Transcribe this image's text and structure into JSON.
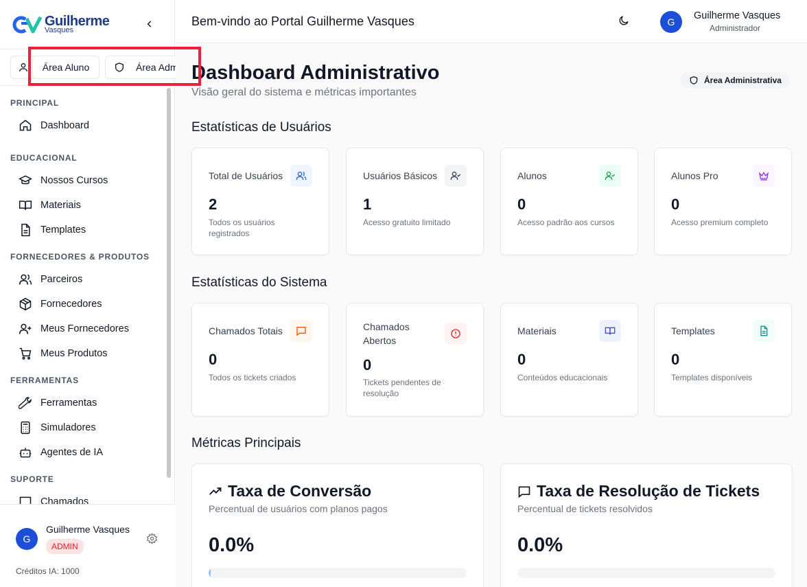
{
  "sidebar": {
    "logo_text_1": "Guilherme",
    "logo_text_2": "Vasques",
    "area_aluno": "Área Aluno",
    "area_admin": "Área Admin",
    "sections": [
      {
        "title": "PRINCIPAL",
        "items": [
          {
            "label": "Dashboard",
            "icon": "home-icon"
          }
        ]
      },
      {
        "title": "EDUCACIONAL",
        "items": [
          {
            "label": "Nossos Cursos",
            "icon": "graduation-cap-icon"
          },
          {
            "label": "Materiais",
            "icon": "book-open-icon"
          },
          {
            "label": "Templates",
            "icon": "file-text-icon"
          }
        ]
      },
      {
        "title": "FORNECEDORES & PRODUTOS",
        "items": [
          {
            "label": "Parceiros",
            "icon": "users-icon"
          },
          {
            "label": "Fornecedores",
            "icon": "package-icon"
          },
          {
            "label": "Meus Fornecedores",
            "icon": "user-plus-icon"
          },
          {
            "label": "Meus Produtos",
            "icon": "cart-icon"
          }
        ]
      },
      {
        "title": "FERRAMENTAS",
        "items": [
          {
            "label": "Ferramentas",
            "icon": "wrench-icon"
          },
          {
            "label": "Simuladores",
            "icon": "calculator-icon"
          },
          {
            "label": "Agentes de IA",
            "icon": "bot-icon"
          }
        ]
      },
      {
        "title": "SUPORTE",
        "items": [
          {
            "label": "Chamados",
            "icon": "message-icon"
          }
        ]
      }
    ],
    "user": {
      "initial": "G",
      "name": "Guilherme Vasques",
      "badge": "ADMIN",
      "credits": "Créditos IA: 1000"
    }
  },
  "header": {
    "title": "Bem-vindo ao Portal Guilherme Vasques",
    "user_initial": "G",
    "user_name": "Guilherme Vasques",
    "user_role": "Administrador"
  },
  "main": {
    "title": "Dashboard Administrativo",
    "subtitle": "Visão geral do sistema e métricas importantes",
    "badge": "Área Administrativa",
    "user_stats_title": "Estatísticas de Usuários",
    "system_stats_title": "Estatísticas do Sistema",
    "metrics_title": "Métricas Principais",
    "user_stats": [
      {
        "label": "Total de Usuários",
        "value": "2",
        "desc": "Todos os usuários registrados",
        "icon": "users-icon",
        "color": "#2563eb",
        "bg": "#eff6ff"
      },
      {
        "label": "Usuários Básicos",
        "value": "1",
        "desc": "Acesso gratuito limitado",
        "icon": "user-check-icon",
        "color": "#374151",
        "bg": "#f3f4f6"
      },
      {
        "label": "Alunos",
        "value": "0",
        "desc": "Acesso padrão aos cursos",
        "icon": "user-check-icon",
        "color": "#16a34a",
        "bg": "#ecfdf5"
      },
      {
        "label": "Alunos Pro",
        "value": "0",
        "desc": "Acesso premium completo",
        "icon": "crown-icon",
        "color": "#9333ea",
        "bg": "#faf5ff"
      }
    ],
    "system_stats": [
      {
        "label": "Chamados Totais",
        "value": "0",
        "desc": "Todos os tickets criados",
        "icon": "message-icon",
        "color": "#ea580c",
        "bg": "#fff7ed"
      },
      {
        "label": "Chamados Abertos",
        "value": "0",
        "desc": "Tickets pendentes de resolução",
        "icon": "alert-circle-icon",
        "color": "#dc2626",
        "bg": "#fef2f2"
      },
      {
        "label": "Materiais",
        "value": "0",
        "desc": "Conteúdos educacionais",
        "icon": "book-open-icon",
        "color": "#4f46e5",
        "bg": "#eef2ff"
      },
      {
        "label": "Templates",
        "value": "0",
        "desc": "Templates disponíveis",
        "icon": "file-text-icon",
        "color": "#0d9488",
        "bg": "#f0fdfa"
      }
    ],
    "metrics": [
      {
        "title": "Taxa de Conversão",
        "subtitle": "Percentual de usuários com planos pagos",
        "value": "0.0%",
        "progress": 0,
        "icon": "trending-up-icon"
      },
      {
        "title": "Taxa de Resolução de Tickets",
        "subtitle": "Percentual de tickets resolvidos",
        "value": "0.0%",
        "progress": 0,
        "icon": "message-icon"
      }
    ]
  }
}
